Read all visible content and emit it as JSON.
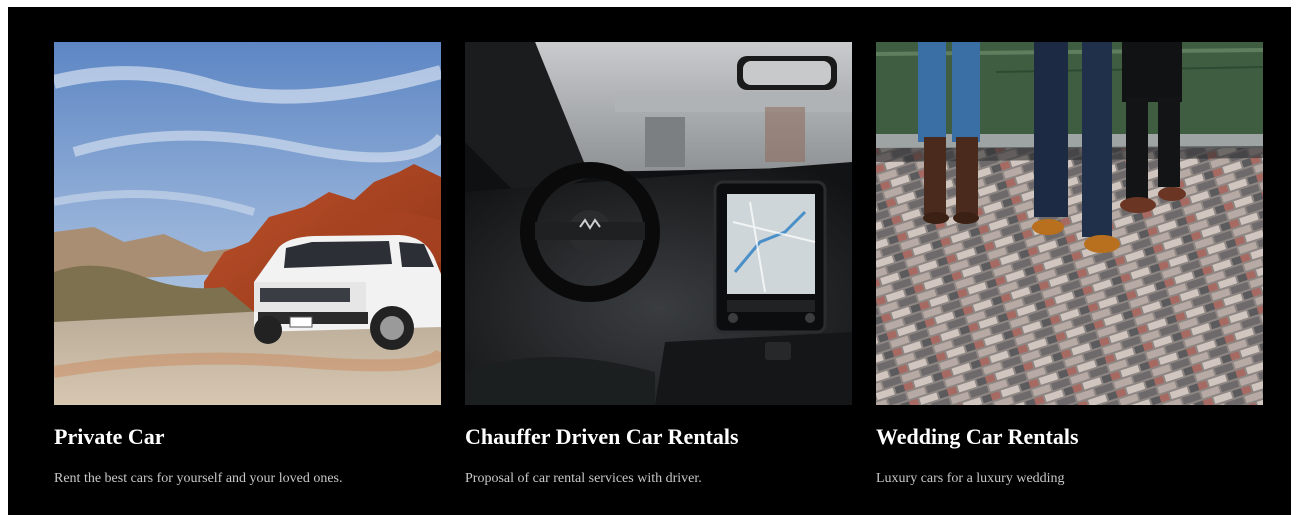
{
  "services": [
    {
      "title": "Private Car",
      "description": "Rent the best cars for yourself and your loved ones."
    },
    {
      "title": "Chauffer Driven Car Rentals",
      "description": "Proposal of car rental services with driver."
    },
    {
      "title": "Wedding Car Rentals",
      "description": "Luxury cars for a luxury wedding"
    }
  ],
  "colors": {
    "background": "#000000",
    "title": "#ffffff",
    "description": "#c8c8c8"
  }
}
